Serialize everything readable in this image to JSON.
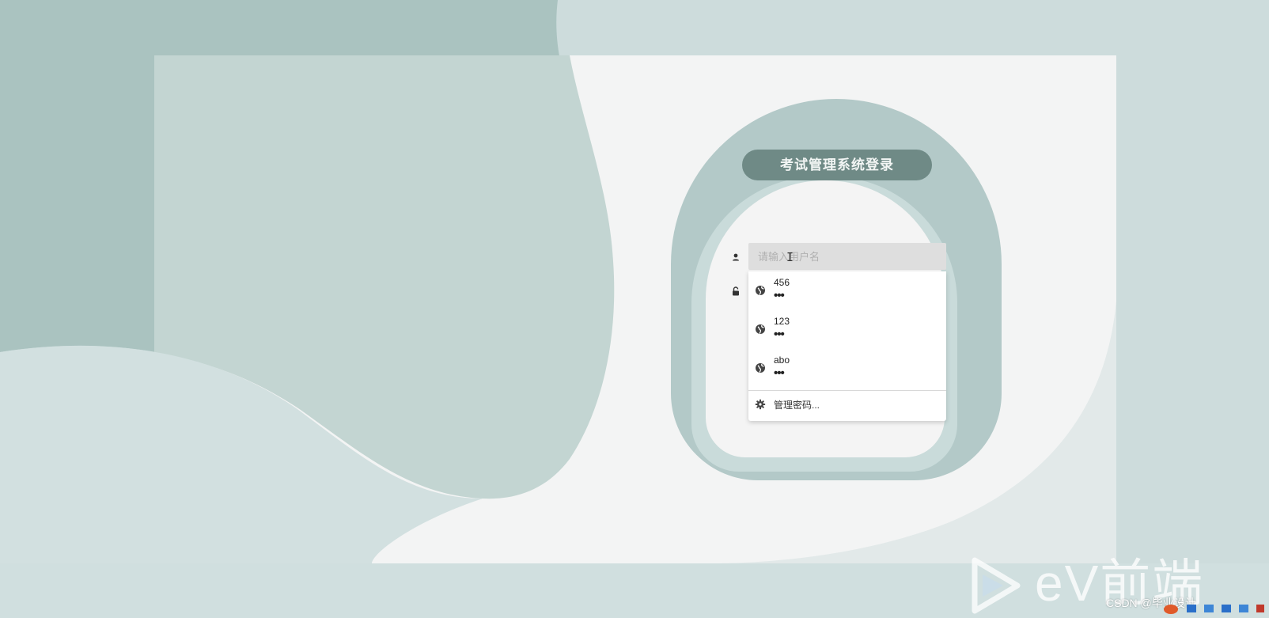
{
  "login": {
    "title": "考试管理系统登录",
    "username_placeholder": "请输入用户名",
    "username_value": ""
  },
  "autofill": {
    "entries": [
      {
        "username": "456",
        "password_mask": "•••"
      },
      {
        "username": "123",
        "password_mask": "•••"
      },
      {
        "username": "abo",
        "password_mask": "•••"
      }
    ],
    "manage_label": "管理密码..."
  },
  "watermark": {
    "brand": "eV前端",
    "csdn": "CSDN @毕业设计"
  },
  "colors": {
    "title_bg": "#6f8a86",
    "frame": "#b3c9c8",
    "panel": "#f4f4f4",
    "input_bg": "#dedede"
  },
  "icons": {
    "username": "user-icon",
    "password": "lock-icon",
    "entry": "globe-icon",
    "manage": "gear-icon"
  }
}
